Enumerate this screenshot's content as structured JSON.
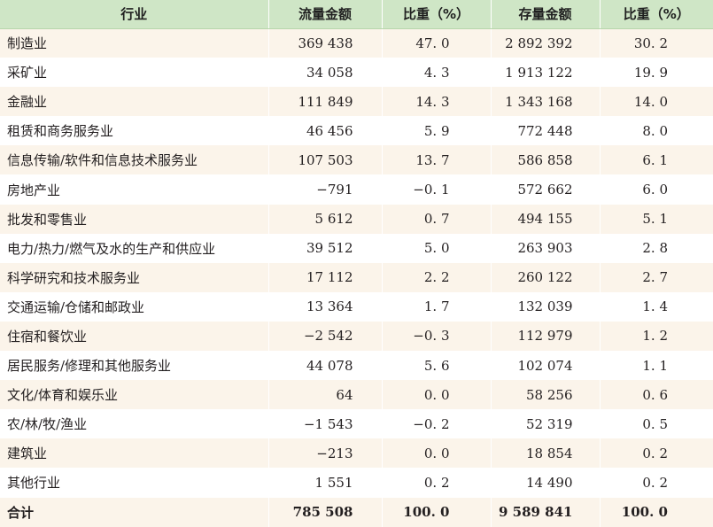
{
  "header": {
    "industry": "行业",
    "flow_amount": "流量金额",
    "flow_share": "比重（%）",
    "stock_amount": "存量金额",
    "stock_share": "比重（%）"
  },
  "rows": [
    {
      "industry": "制造业",
      "flow": "369 438",
      "flow_pct": "47. 0",
      "stock": "2 892 392",
      "stock_pct": "30. 2"
    },
    {
      "industry": "采矿业",
      "flow": "34 058",
      "flow_pct": "4. 3",
      "stock": "1 913 122",
      "stock_pct": "19. 9"
    },
    {
      "industry": "金融业",
      "flow": "111 849",
      "flow_pct": "14. 3",
      "stock": "1 343 168",
      "stock_pct": "14. 0"
    },
    {
      "industry": "租赁和商务服务业",
      "flow": "46 456",
      "flow_pct": "5. 9",
      "stock": "772 448",
      "stock_pct": "8. 0"
    },
    {
      "industry": "信息传输/软件和信息技术服务业",
      "flow": "107 503",
      "flow_pct": "13. 7",
      "stock": "586 858",
      "stock_pct": "6. 1"
    },
    {
      "industry": "房地产业",
      "flow": "−791",
      "flow_pct": "−0. 1",
      "stock": "572 662",
      "stock_pct": "6. 0"
    },
    {
      "industry": "批发和零售业",
      "flow": "5 612",
      "flow_pct": "0. 7",
      "stock": "494 155",
      "stock_pct": "5. 1"
    },
    {
      "industry": "电力/热力/燃气及水的生产和供应业",
      "flow": "39 512",
      "flow_pct": "5. 0",
      "stock": "263 903",
      "stock_pct": "2. 8"
    },
    {
      "industry": "科学研究和技术服务业",
      "flow": "17 112",
      "flow_pct": "2. 2",
      "stock": "260 122",
      "stock_pct": "2. 7"
    },
    {
      "industry": "交通运输/仓储和邮政业",
      "flow": "13 364",
      "flow_pct": "1. 7",
      "stock": "132 039",
      "stock_pct": "1. 4"
    },
    {
      "industry": "住宿和餐饮业",
      "flow": "−2 542",
      "flow_pct": "−0. 3",
      "stock": "112 979",
      "stock_pct": "1. 2"
    },
    {
      "industry": "居民服务/修理和其他服务业",
      "flow": "44 078",
      "flow_pct": "5. 6",
      "stock": "102 074",
      "stock_pct": "1. 1"
    },
    {
      "industry": "文化/体育和娱乐业",
      "flow": "64",
      "flow_pct": "0. 0",
      "stock": "58 256",
      "stock_pct": "0. 6"
    },
    {
      "industry": "农/林/牧/渔业",
      "flow": "−1 543",
      "flow_pct": "−0. 2",
      "stock": "52 319",
      "stock_pct": "0. 5"
    },
    {
      "industry": "建筑业",
      "flow": "−213",
      "flow_pct": "0. 0",
      "stock": "18 854",
      "stock_pct": "0. 2"
    },
    {
      "industry": "其他行业",
      "flow": "1 551",
      "flow_pct": "0. 2",
      "stock": "14 490",
      "stock_pct": "0. 2"
    }
  ],
  "total": {
    "industry": "合计",
    "flow": "785 508",
    "flow_pct": "100. 0",
    "stock": "9 589 841",
    "stock_pct": "100. 0"
  }
}
